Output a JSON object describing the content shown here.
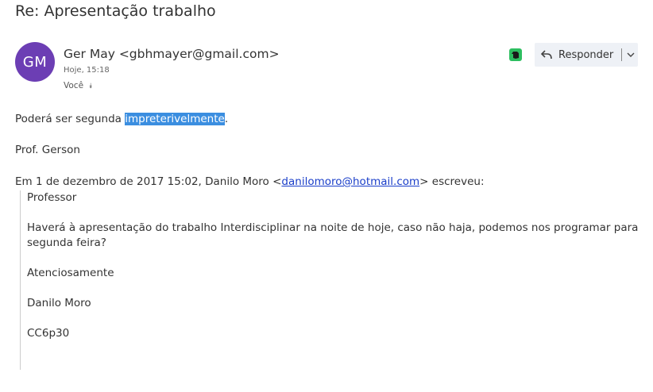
{
  "subject": "Re: Apresentação trabalho",
  "sender": {
    "initials": "GM",
    "avatar_color": "#6c3eb4",
    "display": "Ger May <gbhmayer@gmail.com>",
    "time": "Hoje, 15:18",
    "recipient": "Você"
  },
  "toolbar": {
    "reply_label": "Responder",
    "evernote_color": "#2dbe60"
  },
  "message": {
    "line1_before": "Poderá ser segunda ",
    "line1_highlight": "impreterivelmente",
    "line1_after": ".",
    "signature": "Prof. Gerson",
    "quote_header_before": "Em 1 de dezembro de 2017 15:02, Danilo Moro <",
    "quote_header_link": "danilomoro@hotmail.com",
    "quote_header_after": "> escreveu:"
  },
  "quoted": {
    "greeting": "Professor",
    "body_line1": "Haverá à apresentação do trabalho Interdisciplinar na noite de hoje, caso não haja, podemos nos programar para",
    "body_line2": "segunda feira?",
    "closing": "Atenciosamente",
    "name": "Danilo Moro",
    "code": "CC6p30"
  }
}
